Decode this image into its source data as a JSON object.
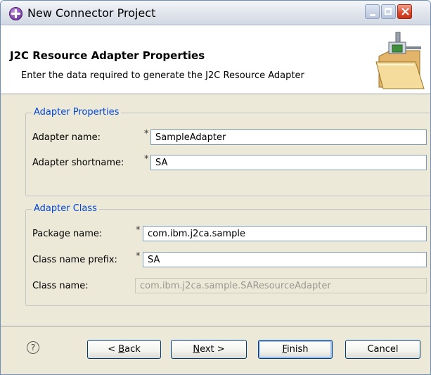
{
  "window": {
    "title": "New Connector Project"
  },
  "header": {
    "title": "J2C Resource Adapter Properties",
    "description": "Enter the data required to generate the J2C Resource Adapter"
  },
  "adapter_properties": {
    "legend": "Adapter Properties",
    "required_marker": "*",
    "adapter_name_label": "Adapter name:",
    "adapter_name_value": "SampleAdapter",
    "adapter_shortname_label": "Adapter shortname:",
    "adapter_shortname_value": "SA"
  },
  "adapter_class": {
    "legend": "Adapter Class",
    "required_marker": "*",
    "package_name_label": "Package name:",
    "package_name_value": "com.ibm.j2ca.sample",
    "class_prefix_label": "Class name prefix:",
    "class_prefix_value": "SA",
    "class_name_label": "Class name:",
    "class_name_value": "com.ibm.j2ca.sample.SAResourceAdapter"
  },
  "buttons": {
    "help": "?",
    "back_prefix": "< ",
    "back_mnemonic": "B",
    "back_rest": "ack",
    "next_mnemonic": "N",
    "next_rest": "ext >",
    "finish_mnemonic": "F",
    "finish_rest": "inish",
    "cancel": "Cancel"
  },
  "icons": {
    "app": "connector-project-icon",
    "banner": "folder-connector-icon",
    "help": "help-icon"
  }
}
